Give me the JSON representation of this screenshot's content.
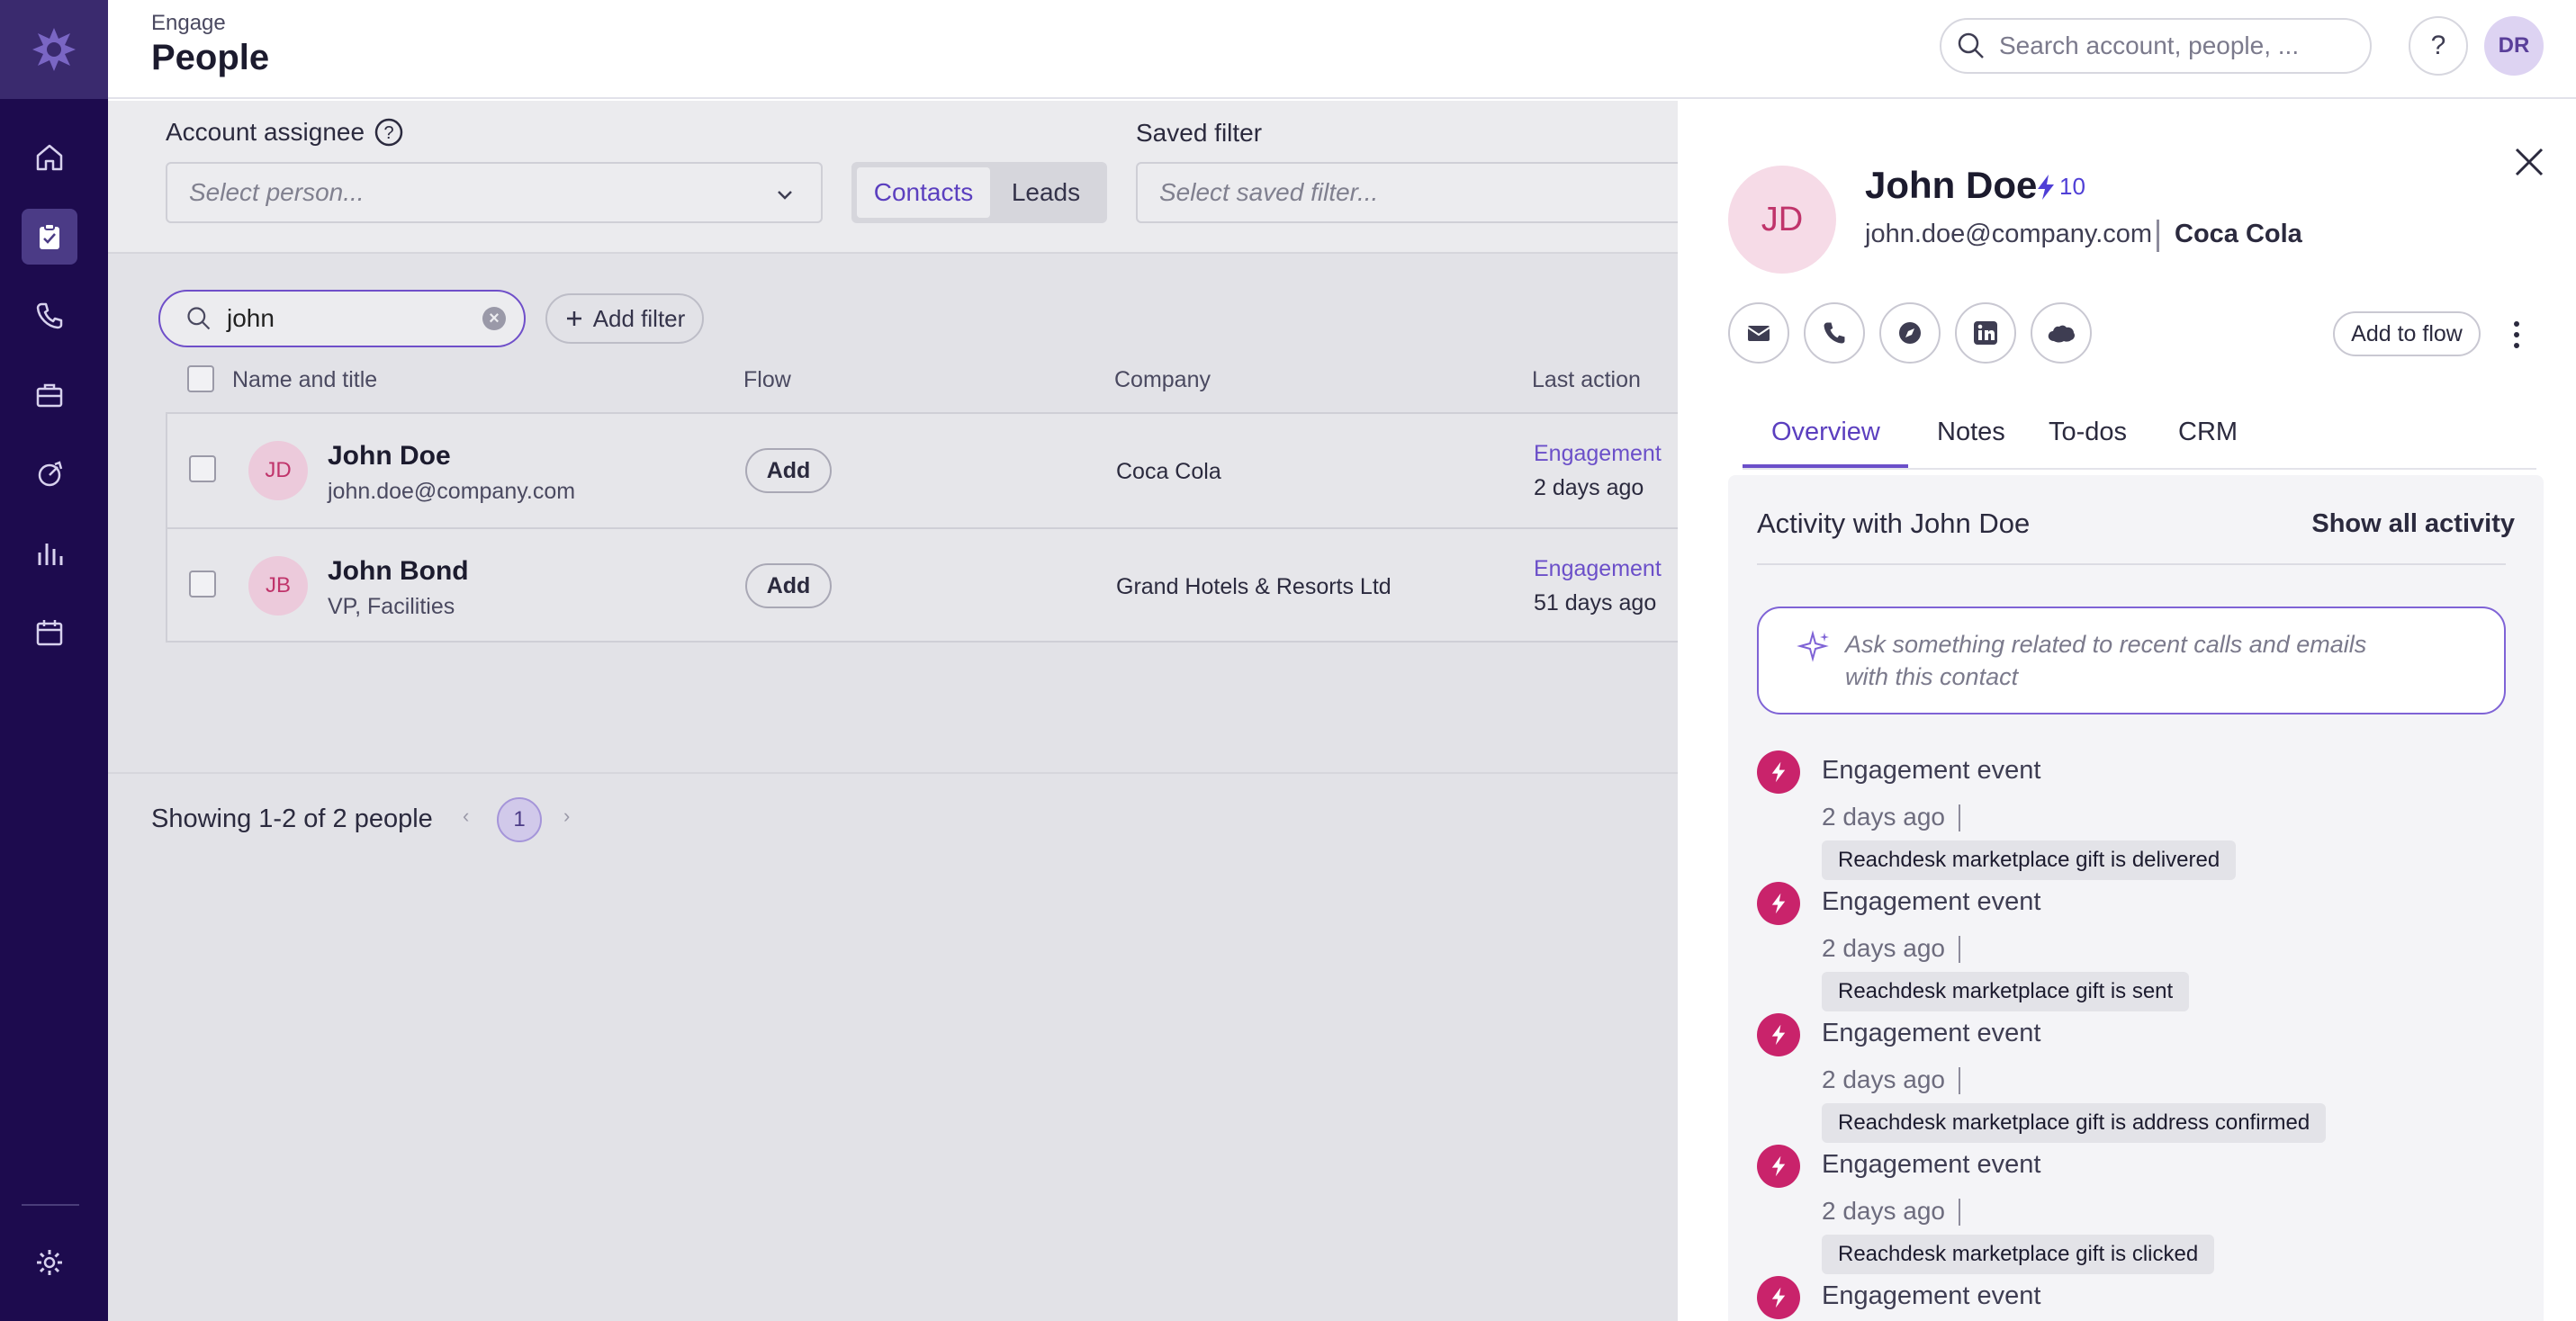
{
  "header": {
    "breadcrumb": "Engage",
    "title": "People",
    "search_placeholder": "Search account, people, ...",
    "help_label": "?",
    "user_initials": "DR"
  },
  "filters": {
    "assignee_label": "Account assignee",
    "assignee_placeholder": "Select person...",
    "segment": [
      "Contacts",
      "Leads"
    ],
    "saved_filter_label": "Saved filter",
    "saved_filter_placeholder": "Select saved filter...",
    "search_value": "john",
    "add_filter_label": "Add filter"
  },
  "table": {
    "columns": [
      "Name and title",
      "Flow",
      "Company",
      "Last action"
    ],
    "rows": [
      {
        "initials": "JD",
        "name": "John Doe",
        "subtitle": "john.doe@company.com",
        "flow": "Add",
        "company": "Coca Cola",
        "last_action": "Engagement",
        "last_action_time": "2 days ago"
      },
      {
        "initials": "JB",
        "name": "John Bond",
        "subtitle": "VP, Facilities",
        "flow": "Add",
        "company": "Grand Hotels & Resorts Ltd",
        "last_action": "Engagement",
        "last_action_time": "51 days ago"
      }
    ]
  },
  "pagination": {
    "summary": "Showing 1-2 of 2 people",
    "prev": "‹",
    "current": "1",
    "next": "›"
  },
  "panel": {
    "initials": "JD",
    "name": "John Doe",
    "score": "10",
    "email": "john.doe@company.com",
    "company": "Coca Cola",
    "add_to_flow": "Add to flow",
    "tabs": [
      "Overview",
      "Notes",
      "To-dos",
      "CRM"
    ],
    "activity_title": "Activity with John Doe",
    "show_all": "Show all activity",
    "ask_placeholder": "Ask something related to recent calls and emails with this contact",
    "events": [
      {
        "title": "Engagement event",
        "time": "2 days ago",
        "tag": "Reachdesk marketplace gift is delivered"
      },
      {
        "title": "Engagement event",
        "time": "2 days ago",
        "tag": "Reachdesk marketplace gift is sent"
      },
      {
        "title": "Engagement event",
        "time": "2 days ago",
        "tag": "Reachdesk marketplace gift is address confirmed"
      },
      {
        "title": "Engagement event",
        "time": "2 days ago",
        "tag": "Reachdesk marketplace gift is clicked"
      },
      {
        "title": "Engagement event"
      }
    ]
  },
  "colors": {
    "nav_bg": "#1d0b4e",
    "accent": "#6b4fc9",
    "event_icon": "#c9236b"
  }
}
